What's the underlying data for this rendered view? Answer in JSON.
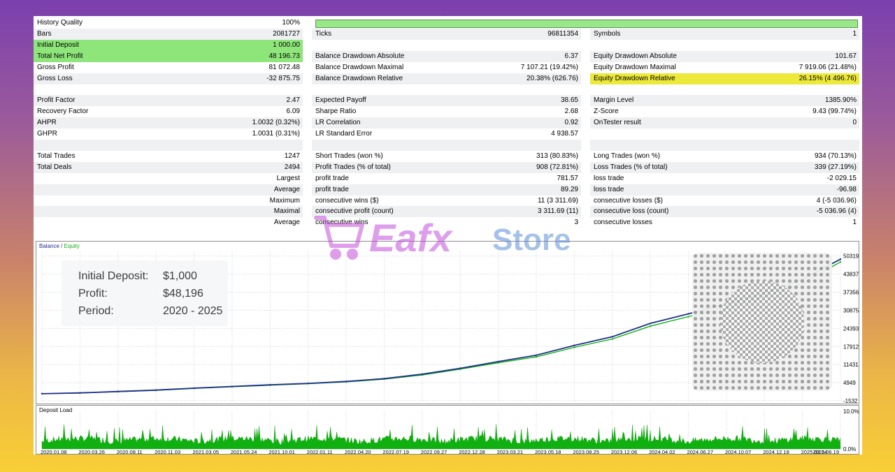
{
  "report": {
    "history_quality": {
      "label": "History Quality",
      "value": "100%"
    },
    "rows": [
      {
        "c1l": "Bars",
        "c1v": "2081727",
        "c2l": "Ticks",
        "c2v": "96811354",
        "c3l": "Symbols",
        "c3v": "1"
      },
      {
        "c1l": "Initial Deposit",
        "c1v": "1 000.00",
        "c2l": "",
        "c2v": "",
        "c3l": "",
        "c3v": ""
      },
      {
        "c1l": "Total Net Profit",
        "c1v": "48 196.73",
        "c2l": "Balance Drawdown Absolute",
        "c2v": "6.37",
        "c3l": "Equity Drawdown Absolute",
        "c3v": "101.67"
      },
      {
        "c1l": "Gross Profit",
        "c1v": "81 072.48",
        "c2l": "Balance Drawdown Maximal",
        "c2v": "7 107.21 (19.42%)",
        "c3l": "Equity Drawdown Maximal",
        "c3v": "7 919.06 (21.48%)"
      },
      {
        "c1l": "Gross Loss",
        "c1v": "-32 875.75",
        "c2l": "Balance Drawdown Relative",
        "c2v": "20.38% (626.76)",
        "c3l": "Equity Drawdown Relative",
        "c3v": "26.15% (4 496.76)"
      },
      {
        "c1l": "",
        "c1v": "",
        "c2l": "",
        "c2v": "",
        "c3l": "",
        "c3v": ""
      },
      {
        "c1l": "Profit Factor",
        "c1v": "2.47",
        "c2l": "Expected Payoff",
        "c2v": "38.65",
        "c3l": "Margin Level",
        "c3v": "1385.90%"
      },
      {
        "c1l": "Recovery Factor",
        "c1v": "6.09",
        "c2l": "Sharpe Ratio",
        "c2v": "2.68",
        "c3l": "Z-Score",
        "c3v": "9.43 (99.74%)"
      },
      {
        "c1l": "AHPR",
        "c1v": "1.0032 (0.32%)",
        "c2l": "LR Correlation",
        "c2v": "0.92",
        "c3l": "OnTester result",
        "c3v": "0"
      },
      {
        "c1l": "GHPR",
        "c1v": "1.0031 (0.31%)",
        "c2l": "LR Standard Error",
        "c2v": "4 938.57",
        "c3l": "",
        "c3v": ""
      },
      {
        "c1l": "",
        "c1v": "",
        "c2l": "",
        "c2v": "",
        "c3l": "",
        "c3v": ""
      },
      {
        "c1l": "Total Trades",
        "c1v": "1247",
        "c2l": "Short Trades (won %)",
        "c2v": "313 (80.83%)",
        "c3l": "Long Trades (won %)",
        "c3v": "934 (70.13%)"
      },
      {
        "c1l": "Total Deals",
        "c1v": "2494",
        "c2l": "Profit Trades (% of total)",
        "c2v": "908 (72.81%)",
        "c3l": "Loss Trades (% of total)",
        "c3v": "339 (27.19%)"
      },
      {
        "c1l": "",
        "c1v": "Largest",
        "c2l": "profit trade",
        "c2v": "781.57",
        "c3l": "loss trade",
        "c3v": "-2 029.15"
      },
      {
        "c1l": "",
        "c1v": "Average",
        "c2l": "profit trade",
        "c2v": "89.29",
        "c3l": "loss trade",
        "c3v": "-96.98"
      },
      {
        "c1l": "",
        "c1v": "Maximum",
        "c2l": "consecutive wins ($)",
        "c2v": "11 (3 311.69)",
        "c3l": "consecutive losses ($)",
        "c3v": "4 (-5 036.96)"
      },
      {
        "c1l": "",
        "c1v": "Maximal",
        "c2l": "consecutive profit (count)",
        "c2v": "3 311.69 (11)",
        "c3l": "consecutive loss (count)",
        "c3v": "-5 036.96 (4)"
      },
      {
        "c1l": "",
        "c1v": "Average",
        "c2l": "consecutive wins",
        "c2v": "3",
        "c3l": "consecutive losses",
        "c3v": "1"
      }
    ]
  },
  "overlay": {
    "rows": [
      {
        "label": "Initial Deposit:",
        "value": "$1,000"
      },
      {
        "label": "Profit:",
        "value": "$48,196"
      },
      {
        "label": "Period:",
        "value": "2020 - 2025"
      }
    ]
  },
  "watermark": {
    "brand1": "Eafx",
    "brand2": "Store"
  },
  "chart_data": [
    {
      "type": "line",
      "legend": [
        "Balance",
        "Equity"
      ],
      "colors": {
        "balance": "#1f2f8f",
        "equity": "#10b010"
      },
      "y_ticks": [
        "50319",
        "43837",
        "37356",
        "30875",
        "24393",
        "17912",
        "11431",
        "4949",
        "-1532"
      ],
      "ylim": [
        -1532,
        52000
      ],
      "x": [
        "2020.01.08",
        "2020.03.26",
        "2020.08.11",
        "2020.11.03",
        "2021.03.05",
        "2021.05.24",
        "2021.10.01",
        "2022.01.11",
        "2022.04.20",
        "2022.07.19",
        "2022.09.27",
        "2022.12.28",
        "2023.03.21",
        "2023.05.18",
        "2023.08.25",
        "2023.12.06",
        "2024.04.02",
        "2024.06.27",
        "2024.10.07",
        "2024.12.18",
        "2025.03.24",
        "2025.06.19"
      ],
      "series": [
        {
          "name": "Balance",
          "values": [
            1000,
            1300,
            1800,
            2300,
            3000,
            3600,
            4200,
            4700,
            5400,
            6400,
            8000,
            10100,
            12500,
            14800,
            18300,
            21400,
            26200,
            29600,
            33200,
            37000,
            42000,
            49200
          ]
        },
        {
          "name": "Equity",
          "values": [
            1000,
            1250,
            1700,
            2200,
            2900,
            3500,
            4050,
            4600,
            5250,
            6200,
            7700,
            9800,
            12100,
            14200,
            17600,
            20600,
            25200,
            28600,
            31800,
            35800,
            40600,
            48200
          ]
        }
      ]
    },
    {
      "type": "bar",
      "title": "Deposit Load",
      "y_ticks": [
        "10.0%",
        "0.0%"
      ],
      "ylim": [
        0,
        10
      ]
    }
  ]
}
